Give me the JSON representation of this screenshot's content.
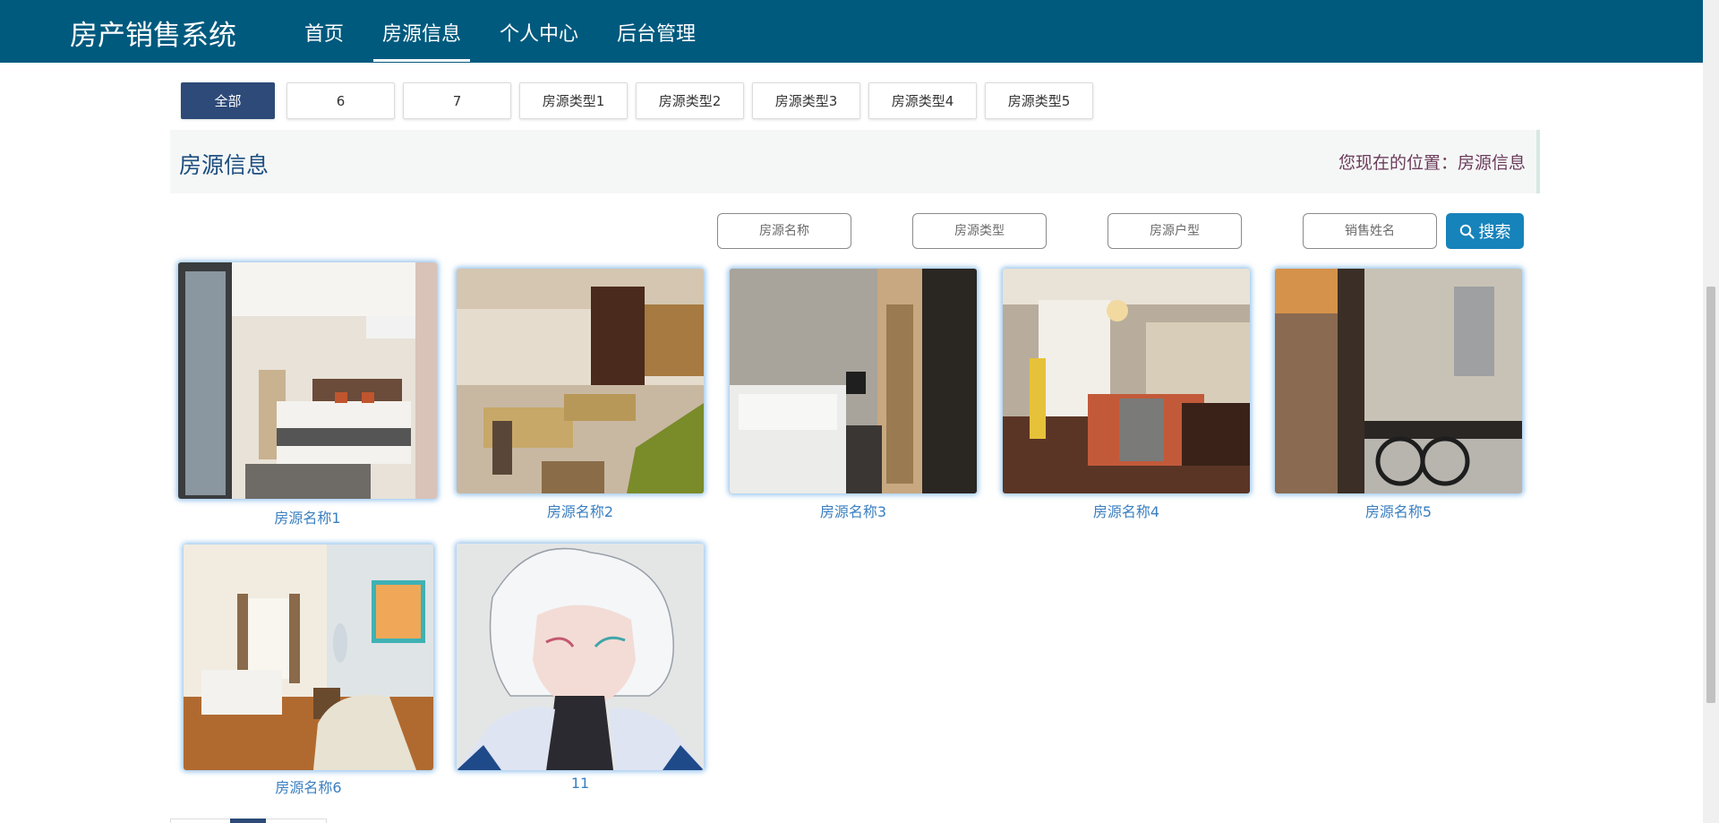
{
  "nav": {
    "brand": "房产销售系统",
    "items": [
      "首页",
      "房源信息",
      "个人中心",
      "后台管理"
    ],
    "active_index": 1
  },
  "tabs": [
    "全部",
    "6",
    "7",
    "房源类型1",
    "房源类型2",
    "房源类型3",
    "房源类型4",
    "房源类型5"
  ],
  "active_tab_index": 0,
  "header": {
    "title": "房源信息",
    "breadcrumb": "您现在的位置：房源信息"
  },
  "search": {
    "name_placeholder": "房源名称",
    "type_placeholder": "房源类型",
    "layout_placeholder": "房源户型",
    "seller_placeholder": "销售姓名",
    "button_label": "搜索"
  },
  "listings": [
    {
      "name": "房源名称1",
      "image": "bedroom with glass door"
    },
    {
      "name": "房源名称2",
      "image": "dining room"
    },
    {
      "name": "房源名称3",
      "image": "bedroom with closet"
    },
    {
      "name": "房源名称4",
      "image": "bedroom with orange bedding"
    },
    {
      "name": "房源名称5",
      "image": "kitchen"
    },
    {
      "name": "房源名称6",
      "image": "hotel room"
    },
    {
      "name": "11",
      "image": "anime character with white hair"
    }
  ],
  "colors": {
    "nav_bg": "#005a7e",
    "tab_active": "#2d4a78",
    "search_button": "#1783bb",
    "caption_text": "#3a7fc0"
  }
}
